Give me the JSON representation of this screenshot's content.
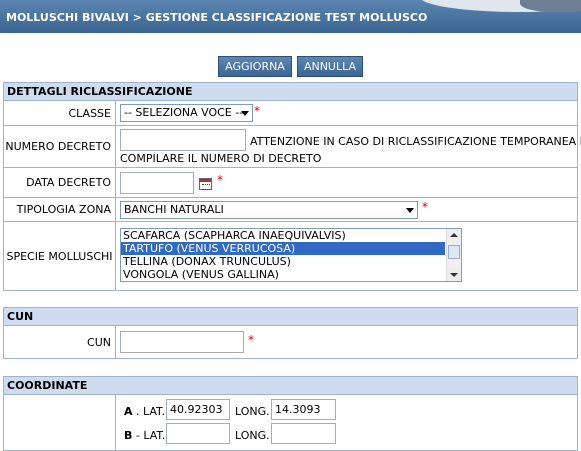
{
  "header": {
    "breadcrumb": "MOLLUSCHI BIVALVI > GESTIONE CLASSIFICAZIONE TEST MOLLUSCO"
  },
  "toolbar": {
    "aggiorna_label": "AGGIORNA",
    "annulla_label": "ANNULLA"
  },
  "dettagli": {
    "title": "DETTAGLI RICLASSIFICAZIONE",
    "required_mark": "*",
    "classe": {
      "label": "CLASSE",
      "value": "-- SELEZIONA VOCE --"
    },
    "numero_decreto": {
      "label": "NUMERO DECRETO",
      "value": "",
      "note_line1": "ATTENZIONE IN CASO DI RICLASSIFICAZIONE TEMPORANEA NON",
      "note_line2": "COMPILARE IL NUMERO DI DECRETO"
    },
    "data_decreto": {
      "label": "DATA DECRETO",
      "value": ""
    },
    "tipologia_zona": {
      "label": "TIPOLOGIA ZONA",
      "value": "BANCHI NATURALI"
    },
    "specie_molluschi": {
      "label": "SPECIE MOLLUSCHI",
      "options": [
        "SCAFARCA (SCAPHARCA INAEQUIVALVIS)",
        "TARTUFO (VENUS VERRUCOSA)",
        "TELLINA (DONAX TRUNCULUS)",
        "VONGOLA (VENUS GALLINA)"
      ],
      "selected": "TARTUFO (VENUS VERRUCOSA)"
    }
  },
  "cun": {
    "title": "CUN",
    "label": "CUN",
    "value": "",
    "required_mark": "*"
  },
  "coordinate": {
    "title": "COORDINATE",
    "a_letter": "A",
    "b_letter": "B",
    "lat_label": ". LAT.",
    "lat_label_b": "- LAT.",
    "long_label": "LONG.",
    "a_lat": "40.92303",
    "a_long": "14.3093",
    "b_lat": "",
    "b_long": ""
  },
  "colors": {
    "header_blue": "#3b6591",
    "section_head_bg": "#cfdcf0",
    "border": "#9fb3cc",
    "required": "#e00000",
    "selection": "#316ac5"
  }
}
